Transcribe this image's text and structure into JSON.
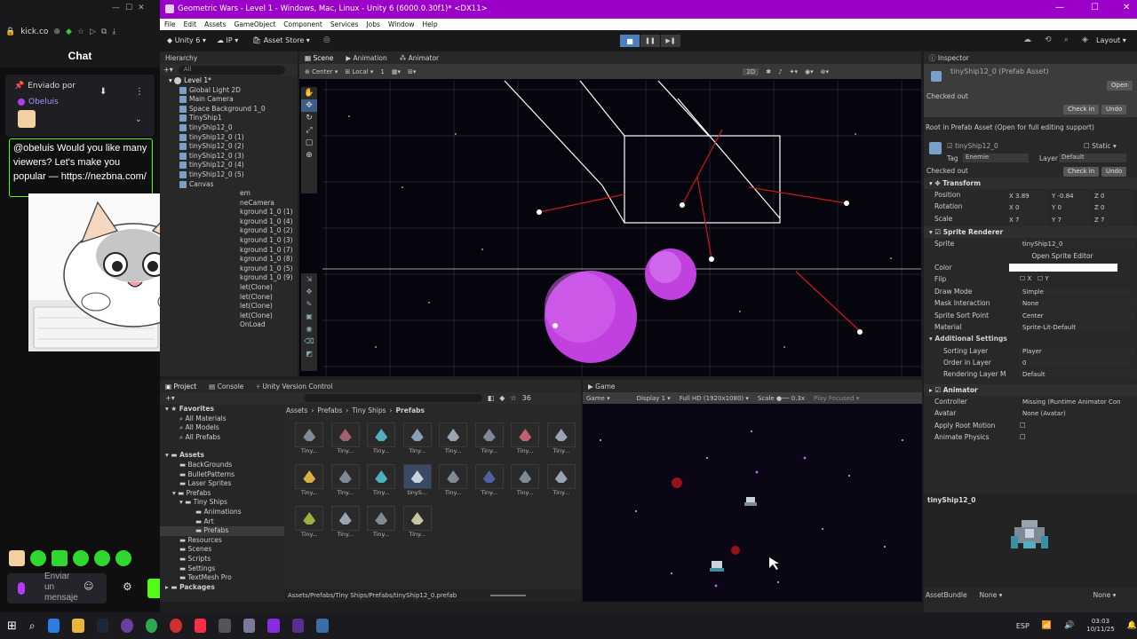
{
  "kick": {
    "address": "kick.co",
    "chat_title": "Chat",
    "pinned_label": "Enviado por",
    "pinned_user": "Obeluis",
    "pinned_message": "@obeluis Would you like many viewers? Let's make you popular — https://nezbna.com/",
    "send_placeholder": "Enviar un mensaje"
  },
  "unity": {
    "window_title": "Geometric Wars - Level 1 - Windows, Mac, Linux - Unity 6 (6000.0.30f1)* <DX11>",
    "menu": [
      "File",
      "Edit",
      "Assets",
      "GameObject",
      "Component",
      "Services",
      "Jobs",
      "Window",
      "Help"
    ],
    "toolbar": {
      "brand": "Unity 6",
      "ip": "IP",
      "asset_store": "Asset Store",
      "layout": "Layout"
    },
    "hierarchy": {
      "tab": "Hierarchy",
      "search": "All",
      "scene": "Level 1*",
      "items": [
        "Global Light 2D",
        "Main Camera",
        "Space Background 1_0",
        "TinyShip1",
        "tinyShip12_0",
        "tinyShip12_0 (1)",
        "tinyShip12_0 (2)",
        "tinyShip12_0 (3)",
        "tinyShip12_0 (4)",
        "tinyShip12_0 (5)",
        "Canvas"
      ],
      "hidden_items": [
        "em",
        "neCamera",
        "kground 1_0 (1)",
        "kground 1_0 (4)",
        "kground 1_0 (2)",
        "kground 1_0 (3)",
        "kground 1_0 (7)",
        "kground 1_0 (8)",
        "kground 1_0 (5)",
        "kground 1_0 (9)",
        "let(Clone)",
        "let(Clone)",
        "let(Clone)",
        "let(Clone)",
        "OnLoad"
      ]
    },
    "scene": {
      "tabs": [
        "Scene",
        "Animation",
        "Animator"
      ],
      "center": "Center",
      "local": "Local",
      "snap": "1",
      "mode2d": "2D"
    },
    "project": {
      "tabs": [
        "Project",
        "Console",
        "Unity Version Control"
      ],
      "favorites_title": "Favorites",
      "favorites": [
        "All Materials",
        "All Models",
        "All Prefabs"
      ],
      "assets_title": "Assets",
      "folders": [
        "BackGrounds",
        "BulletPatterns",
        "Laser Sprites",
        "Prefabs",
        "Tiny Ships",
        "Animations",
        "Art",
        "Prefabs",
        "Resources",
        "Scenes",
        "Scripts",
        "Settings",
        "TextMesh Pro"
      ],
      "packages": "Packages",
      "breadcrumb": [
        "Assets",
        "Prefabs",
        "Tiny Ships",
        "Prefabs"
      ],
      "prefab_count": "36",
      "prefab_labels": [
        "Tiny...",
        "Tiny...",
        "Tiny...",
        "Tiny...",
        "Tiny...",
        "Tiny...",
        "Tiny...",
        "Tiny...",
        "Tiny...",
        "Tiny...",
        "Tiny...",
        "tinyS...",
        "Tiny...",
        "Tiny...",
        "Tiny...",
        "Tiny...",
        "Tiny...",
        "Tiny...",
        "Tiny...",
        "Tiny..."
      ],
      "path": "Assets/Prefabs/Tiny Ships/Prefabs/tinyShip12_0.prefab"
    },
    "game": {
      "tab": "Game",
      "mode": "Game",
      "display": "Display 1",
      "resolution": "Full HD (1920x1080)",
      "scale_label": "Scale",
      "scale": "0.3x",
      "play_focused": "Play Focused"
    },
    "inspector": {
      "tab": "Inspector",
      "asset_title": "tinyShip12_0 (Prefab Asset)",
      "open": "Open",
      "checked_out": "Checked out",
      "check_in": "Check in",
      "undo": "Undo",
      "root_note": "Root in Prefab Asset (Open for full editing support)",
      "object_name": "tinyShip12_0",
      "static": "Static",
      "tag_label": "Tag",
      "tag": "Enemie",
      "layer_label": "Layer",
      "layer": "Default",
      "transform": "Transform",
      "position_label": "Position",
      "rotation_label": "Rotation",
      "scale_label": "Scale",
      "position": [
        "3.89",
        "-0.84",
        "0"
      ],
      "rotation": [
        "0",
        "0",
        "0"
      ],
      "scale": [
        "7",
        "7",
        "7"
      ],
      "sprite_renderer": "Sprite Renderer",
      "sprite_label": "Sprite",
      "sprite": "tinyShip12_0",
      "open_sprite_editor": "Open Sprite Editor",
      "color_label": "Color",
      "flip_label": "Flip",
      "flip_x": "X",
      "flip_y": "Y",
      "draw_mode_label": "Draw Mode",
      "draw_mode": "Simple",
      "mask_label": "Mask Interaction",
      "mask": "None",
      "sort_point_label": "Sprite Sort Point",
      "sort_point": "Center",
      "material_label": "Material",
      "material": "Sprite-Lit-Default",
      "additional": "Additional Settings",
      "sorting_layer_label": "Sorting Layer",
      "sorting_layer": "Player",
      "order_label": "Order in Layer",
      "order": "0",
      "rendering_layer_label": "Rendering Layer M",
      "rendering_layer": "Default",
      "animator": "Animator",
      "controller_label": "Controller",
      "controller": "Missing (Runtime Animator Con",
      "avatar_label": "Avatar",
      "avatar": "None (Avatar)",
      "root_motion": "Apply Root Motion",
      "animate_physics": "Animate Physics",
      "preview_name": "tinyShip12_0",
      "asset_bundle_label": "AssetBundle",
      "asset_bundle": "None",
      "asset_bundle_variant": "None"
    }
  },
  "taskbar": {
    "time": "03:03",
    "date": "10/11/25",
    "lang": "ESP"
  },
  "colors": {
    "title_bar": "#9a00c8",
    "scene_bg": "#06040c",
    "planet": "#c040e0",
    "laser": "#d01818"
  }
}
